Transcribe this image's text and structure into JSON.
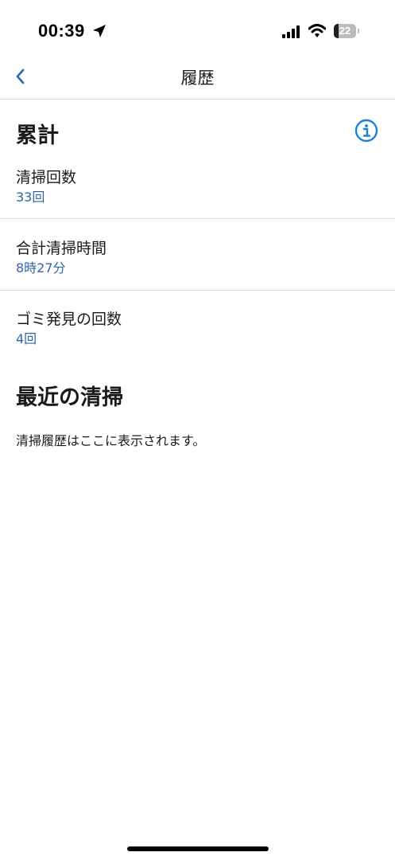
{
  "status_bar": {
    "time": "00:39",
    "battery_level": "22",
    "battery_fraction": 0.22
  },
  "nav": {
    "title": "履歴",
    "back_icon": "chevron-left-icon"
  },
  "totals": {
    "header": "累計",
    "info_icon": "info-icon",
    "stats": [
      {
        "label": "清掃回数",
        "value": "33回"
      },
      {
        "label": "合計清掃時間",
        "value": "8時27分"
      },
      {
        "label": "ゴミ発見の回数",
        "value": "4回"
      }
    ]
  },
  "recent": {
    "header": "最近の清掃",
    "empty_message": "清掃履歴はここに表示されます。"
  },
  "colors": {
    "accent": "#2E66A8",
    "info_icon": "#1E7FD6",
    "divider": "#DCDCDC"
  }
}
